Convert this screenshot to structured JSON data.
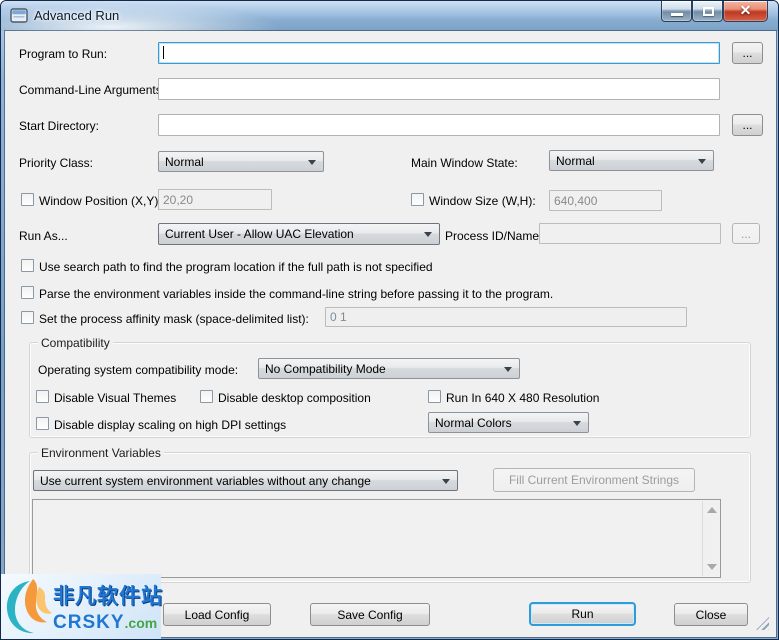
{
  "titlebar": {
    "title": "Advanced Run"
  },
  "form": {
    "program_to_run": {
      "label": "Program to Run:",
      "value": "",
      "browse": "..."
    },
    "command_line": {
      "label": "Command-Line Arguments:",
      "value": ""
    },
    "start_directory": {
      "label": "Start Directory:",
      "value": "",
      "browse": "..."
    },
    "priority_class": {
      "label": "Priority Class:",
      "value": "Normal"
    },
    "main_window_state": {
      "label": "Main Window State:",
      "value": "Normal"
    },
    "window_position": {
      "label": "Window Position (X,Y):",
      "value": "20,20"
    },
    "window_size": {
      "label": "Window Size (W,H):",
      "value": "640,400"
    },
    "run_as": {
      "label": "Run As...",
      "value": "Current User - Allow UAC Elevation"
    },
    "process_id": {
      "label": "Process ID/Name:",
      "value": "",
      "browse": "..."
    },
    "checks": {
      "search_path": "Use search path to find the program location if the full path is not specified",
      "parse_env": "Parse the environment variables inside the command-line string before passing it to the program.",
      "affinity_label": "Set the process affinity mask (space-delimited list):",
      "affinity_value": "0 1"
    }
  },
  "compatibility": {
    "legend": "Compatibility",
    "os_mode_label": "Operating system compatibility mode:",
    "os_mode_value": "No Compatibility Mode",
    "disable_visual_themes": "Disable Visual Themes",
    "disable_desktop_composition": "Disable desktop composition",
    "run_640": "Run In 640 X 480 Resolution",
    "disable_dpi_scaling": "Disable display scaling on high DPI settings",
    "colors_value": "Normal Colors"
  },
  "environment": {
    "legend": "Environment Variables",
    "mode_value": "Use current system environment variables without any change",
    "fill_button": "Fill Current Environment Strings",
    "variables_text": ""
  },
  "buttons": {
    "load_config": "Load Config",
    "save_config": "Save Config",
    "run": "Run",
    "close": "Close"
  },
  "watermark": {
    "site_name": "非凡软件站",
    "site_domain": "CRSKY",
    "site_tld": ".com"
  }
}
